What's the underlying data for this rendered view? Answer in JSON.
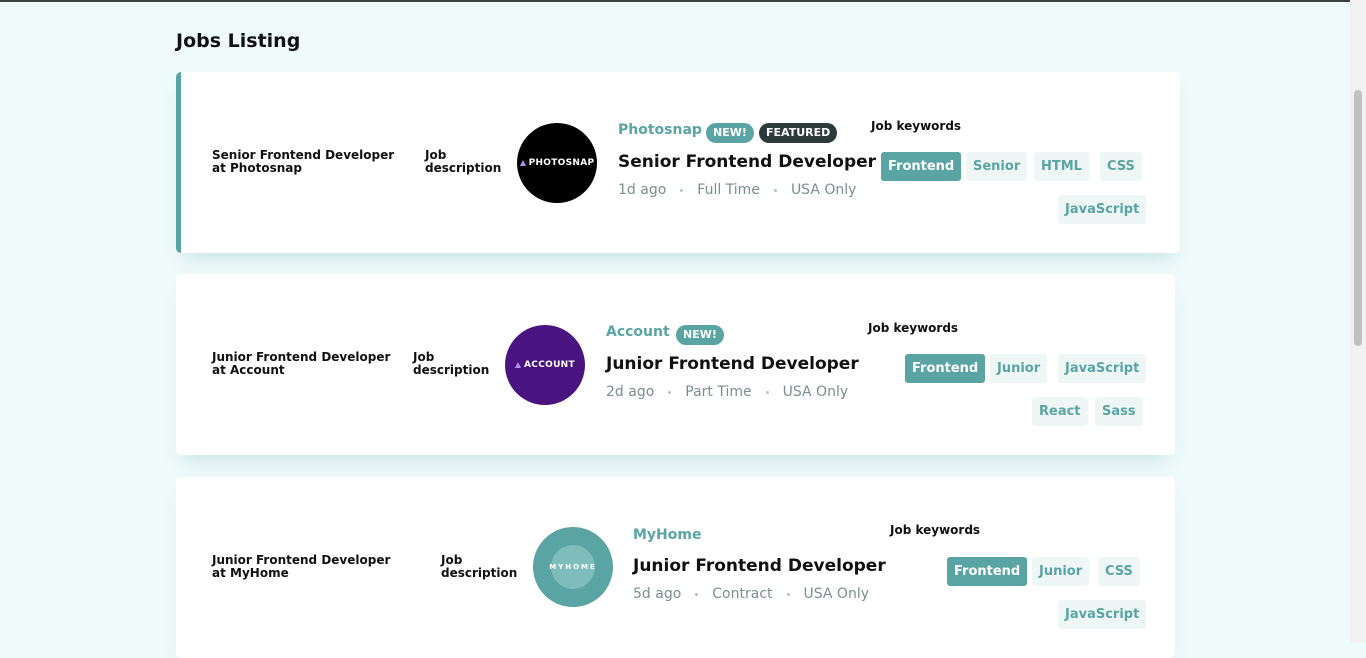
{
  "page": {
    "title": "Jobs Listing"
  },
  "jobs": [
    {
      "sr_title": "Senior Frontend Developer at Photosnap",
      "sr_desc": "Job description",
      "logo_text": "PHOTOSNAP",
      "logo_color": "#000000",
      "company": "Photosnap",
      "badges": [
        "NEW!",
        "FEATURED"
      ],
      "position": "Senior Frontend Developer",
      "posted": "1d ago",
      "contract": "Full Time",
      "location": "USA Only",
      "keywords_label": "Job keywords",
      "tags": [
        "Frontend",
        "Senior",
        "HTML",
        "CSS",
        "JavaScript"
      ]
    },
    {
      "sr_title": "Junior Frontend Developer at Account",
      "sr_desc": "Job description",
      "logo_text": "ACCOUNT",
      "logo_color": "#4a1480",
      "company": "Account",
      "badges": [
        "NEW!"
      ],
      "position": "Junior Frontend Developer",
      "posted": "2d ago",
      "contract": "Part Time",
      "location": "USA Only",
      "keywords_label": "Job keywords",
      "tags": [
        "Frontend",
        "Junior",
        "JavaScript",
        "React",
        "Sass"
      ]
    },
    {
      "sr_title": "Junior Frontend Developer at MyHome",
      "sr_desc": "Job description",
      "logo_text": "MYHOME",
      "logo_color": "#5ba4a4",
      "company": "MyHome",
      "badges": [],
      "position": "Junior Frontend Developer",
      "posted": "5d ago",
      "contract": "Contract",
      "location": "USA Only",
      "keywords_label": "Job keywords",
      "tags": [
        "Frontend",
        "Junior",
        "CSS",
        "JavaScript"
      ]
    }
  ],
  "colors": {
    "accent": "#5ba4a4",
    "background": "#effafa",
    "tag_bg": "#eef6f6",
    "featured_badge": "#2c3a3a"
  }
}
